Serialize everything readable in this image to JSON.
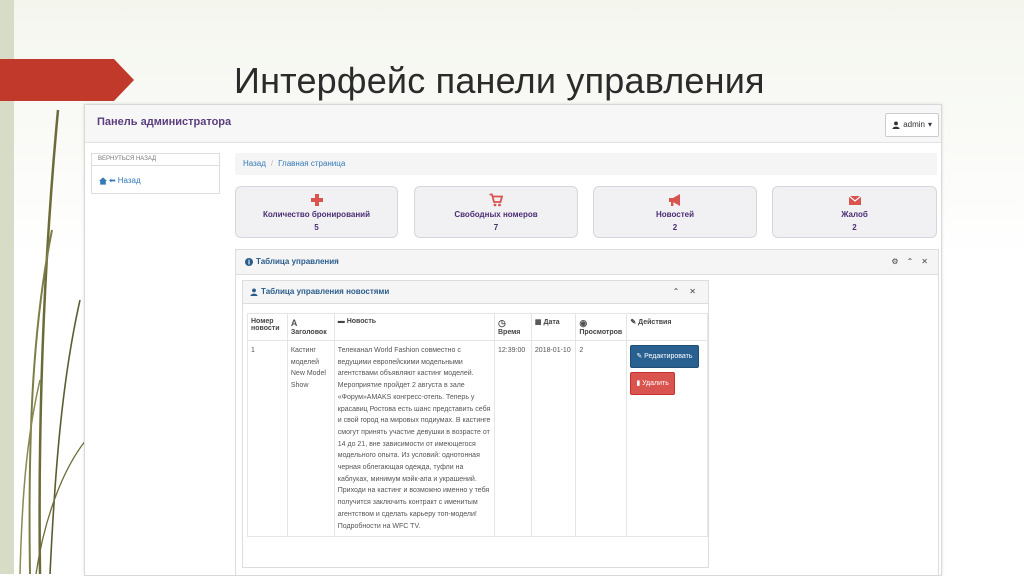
{
  "slide": {
    "title": "Интерфейс панели управления"
  },
  "navbar": {
    "brand": "Панель администратора",
    "user": "admin"
  },
  "sidebar": {
    "heading": "ВЕРНУТЬСЯ НАЗАД",
    "back_label": "Назад"
  },
  "breadcrumb": {
    "items": [
      "Назад",
      "Главная страница"
    ]
  },
  "stats": [
    {
      "label": "Количество бронирований",
      "value": "5",
      "icon": "plus-icon",
      "color": "#d9534f"
    },
    {
      "label": "Свободных номеров",
      "value": "7",
      "icon": "cart-icon",
      "color": "#d9534f"
    },
    {
      "label": "Новостей",
      "value": "2",
      "icon": "bullhorn-icon",
      "color": "#d9534f"
    },
    {
      "label": "Жалоб",
      "value": "2",
      "icon": "envelope-icon",
      "color": "#d9534f"
    }
  ],
  "panel": {
    "title": "Таблица управления"
  },
  "news_panel": {
    "title": "Таблица управления новостями",
    "columns": [
      "Номер новости",
      "Заголовок",
      "Новость",
      "Время",
      "Дата",
      "Просмотров",
      "Действия"
    ],
    "rows": [
      {
        "id": "1",
        "heading": "Кастинг моделей New Model Show",
        "text": "Телеканал World Fashion совместно с ведущими европейскими модельными агентствами объявляют кастинг моделей. Мероприятие пройдет 2 августа в зале «Форум»AMAKS конгресс-отель. Теперь у красавиц Ростова есть шанс представить себя и свой город на мировых подиумах. В кастинге смогут принять участие девушки в возрасте от 14 до 21, вне зависимости от имеющегося модельного опыта. Из условий: однотонная черная облегающая одежда, туфли на каблуках, минимум мэйк-апа и украшений. Приходи на кастинг и возможно именно у тебя получится заключить контракт с именитым агентством и сделать карьеру топ-модели! Подробности на WFC TV.",
        "time": "12:39:00",
        "date": "2018-01-10",
        "views": "2"
      }
    ],
    "edit_label": "Редактировать",
    "delete_label": "Удалить"
  },
  "colors": {
    "accent_red": "#c0392b",
    "brand_purple": "#5b3f7d",
    "link_blue": "#337ab7",
    "edit_button": "#286090",
    "delete_button": "#d9534f"
  }
}
